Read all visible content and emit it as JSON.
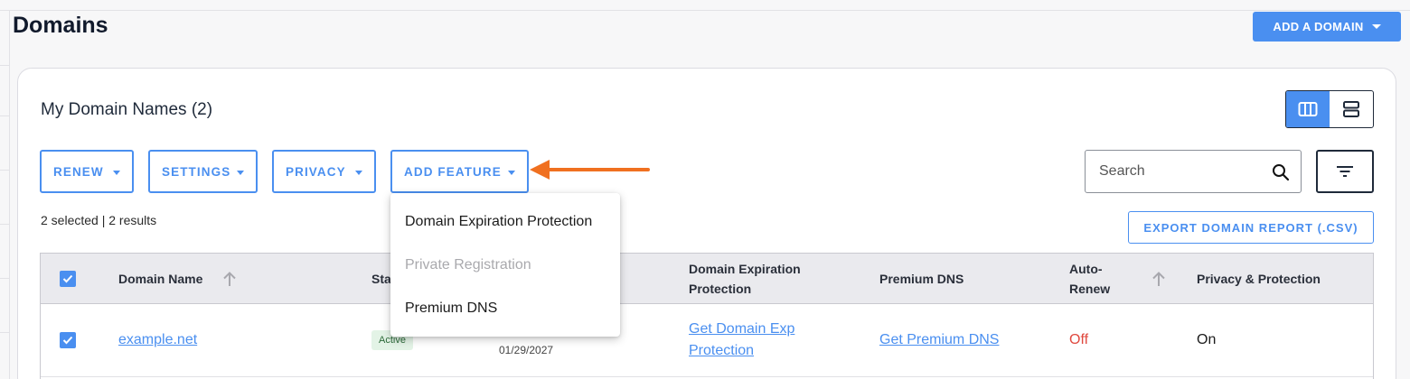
{
  "page": {
    "title": "Domains"
  },
  "header": {
    "add_domain_label": "ADD A DOMAIN"
  },
  "card": {
    "title": "My Domain Names (2)"
  },
  "toolbar": {
    "renew_label": "RENEW",
    "settings_label": "SETTINGS",
    "privacy_label": "PRIVACY",
    "add_feature_label": "ADD FEATURE",
    "export_label": "EXPORT DOMAIN REPORT (.CSV)"
  },
  "search": {
    "placeholder": "Search"
  },
  "selection": {
    "info": "2 selected | 2 results"
  },
  "table": {
    "columns": {
      "domain_name": "Domain Name",
      "status": "Sta",
      "expiration_protection_1": "Domain Expiration",
      "expiration_protection_2": "Protection",
      "premium_dns": "Premium DNS",
      "auto_renew_1": "Auto-",
      "auto_renew_2": "Renew",
      "privacy": "Privacy & Protection"
    },
    "rows": [
      {
        "domain": "example.net",
        "status": "Active",
        "expires": "01/29/2027",
        "expiration_protection_1": "Get Domain Exp",
        "expiration_protection_2": "Protection",
        "premium_dns": "Get Premium DNS",
        "auto_renew": "Off",
        "privacy": "On"
      }
    ]
  },
  "dropdown": {
    "items": [
      {
        "label": "Domain Expiration Protection",
        "enabled": true
      },
      {
        "label": "Private Registration",
        "enabled": false
      },
      {
        "label": "Premium DNS",
        "enabled": true
      }
    ]
  },
  "colors": {
    "accent": "#4a8ff0",
    "off": "#e0493f",
    "annotation_arrow": "#f07020",
    "active_badge": "#e3f3e6"
  }
}
